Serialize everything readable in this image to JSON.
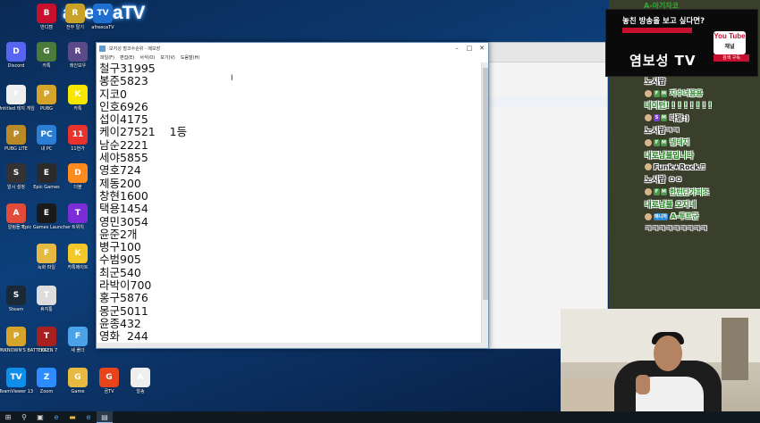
{
  "desktop": {
    "logo_text": "afreecaTV",
    "icons": [
      {
        "label": "반디캠",
        "name": "bandicam-icon",
        "color": "#c8102e",
        "glyph": "B"
      },
      {
        "label": "전부 탈기",
        "name": "tool-icon",
        "color": "#c9a227",
        "glyph": "R"
      },
      {
        "label": "afreecaTV",
        "name": "afreecatv-icon",
        "color": "#1f6fd0",
        "glyph": "TV"
      },
      {
        "label": "Discord",
        "name": "discord-icon",
        "color": "#5865f2",
        "glyph": "D"
      },
      {
        "label": "카톡",
        "name": "game-icon",
        "color": "#4c7a3a",
        "glyph": "G"
      },
      {
        "label": "레인보우",
        "name": "rainbow-icon",
        "color": "#5a4a8a",
        "glyph": "R"
      },
      {
        "label": "Untitled 테지 게임",
        "name": "file-icon",
        "color": "#eeeeee",
        "glyph": "F"
      },
      {
        "label": "PUBG",
        "name": "pubg-icon",
        "color": "#d4a52a",
        "glyph": "P"
      },
      {
        "label": "카톡",
        "name": "kakao-icon",
        "color": "#f7e600",
        "glyph": "K"
      },
      {
        "label": "PUBG LITE",
        "name": "pubg-lite-icon",
        "color": "#b98a26",
        "glyph": "P"
      },
      {
        "label": "내 PC",
        "name": "pc-icon",
        "color": "#2a7fd4",
        "glyph": "PC"
      },
      {
        "label": "11번가",
        "name": "11st-icon",
        "color": "#e8322b",
        "glyph": "11"
      },
      {
        "label": "알시 설정",
        "name": "settings-icon",
        "color": "#333333",
        "glyph": "S"
      },
      {
        "label": "Epic Games",
        "name": "epic-icon",
        "color": "#2b2b2b",
        "glyph": "E"
      },
      {
        "label": "더블",
        "name": "double-icon",
        "color": "#ff8a1d",
        "glyph": "D"
      },
      {
        "label": "알림돌기",
        "name": "alert-icon",
        "color": "#e24a3a",
        "glyph": "A"
      },
      {
        "label": "Epic Games Launcher",
        "name": "epic-launcher-icon",
        "color": "#1a1a1a",
        "glyph": "E"
      },
      {
        "label": "트위치",
        "name": "twitch-icon",
        "color": "#7d2dd8",
        "glyph": "T"
      },
      {
        "label": "",
        "name": "blank-icon",
        "color": "#e8e8e8",
        "glyph": ""
      },
      {
        "label": "녹화 파일",
        "name": "folder-icon",
        "color": "#e6b940",
        "glyph": "F"
      },
      {
        "label": "카톡메이트",
        "name": "play-icon",
        "color": "#f2c928",
        "glyph": "K"
      },
      {
        "label": "Steam",
        "name": "steam-icon",
        "color": "#1b2838",
        "glyph": "S"
      },
      {
        "label": "휴지통",
        "name": "trash-icon",
        "color": "#dddddd",
        "glyph": "T"
      },
      {
        "label": "PLAYERUNKNOWN'S BATTLEG...",
        "name": "pubg-full-icon",
        "color": "#d4a52a",
        "glyph": "P"
      },
      {
        "label": "TEKKEN 7",
        "name": "tekken-icon",
        "color": "#a82020",
        "glyph": "T"
      },
      {
        "label": "새 폴더",
        "name": "new-folder-icon",
        "color": "#4aa3e8",
        "glyph": "F"
      },
      {
        "label": "TeamViewer 13",
        "name": "teamviewer-icon",
        "color": "#0e8ee9",
        "glyph": "TV"
      },
      {
        "label": "Zoom",
        "name": "zoom-icon",
        "color": "#2d8cff",
        "glyph": "Z"
      },
      {
        "label": "Game",
        "name": "game-folder-icon",
        "color": "#e6b940",
        "glyph": "G"
      },
      {
        "label": "곰TV",
        "name": "gomtv-icon",
        "color": "#e8441c",
        "glyph": "G"
      },
      {
        "label": "알송",
        "name": "alsong-icon",
        "color": "#eeeeee",
        "glyph": "A"
      }
    ]
  },
  "notepad": {
    "title": "보지성 벌코수순위 - 메모장",
    "menu": [
      "파일(F)",
      "편집(E)",
      "서식(O)",
      "보기(V)",
      "도움말(H)"
    ],
    "lines": [
      "철구31995",
      "봉준5823",
      "지코0",
      "인호6926",
      "섭이4175",
      "케이27521    1등",
      "남순2221",
      "세야5855",
      "영호724",
      "제동200",
      "창현1600",
      "택용1454",
      "영민3054",
      "윤준2개",
      "병구100",
      "수범905",
      "최군540",
      "라박이700",
      "홍구5876",
      "몽군5011",
      "윤종432",
      "영화  244"
    ]
  },
  "banner": {
    "top_nick": "A-아기자코",
    "subtitle": "놓친 방송을 보고 싶다면?",
    "main": "염보성 TV",
    "yt_logo": "You Tube",
    "yt_sub": "채널",
    "subscribe": "검색 구독"
  },
  "chat": [
    {
      "nick": "",
      "msg": "노시랍",
      "badges": []
    },
    {
      "nick": "지수녀용용",
      "msg": "",
      "badges": [
        "F",
        "M"
      ],
      "nick_color": "#2a8a2a"
    },
    {
      "nick": "",
      "msg": "네이턴! ! ! ! ! ! ! !",
      "badges": [],
      "msg_color": "#1a7a1a"
    },
    {
      "nick": "다랑:)",
      "msg": "",
      "badges": [
        "S",
        "M"
      ],
      "nick_color": "#2a2a2a"
    },
    {
      "nick": "",
      "msg": "노시랍ㅋㅋ",
      "badges": []
    },
    {
      "nick": "넴테지",
      "msg": "",
      "badges": [
        "F",
        "M"
      ],
      "nick_color": "#2a8a2a"
    },
    {
      "nick": "",
      "msg": "내로남불입니다",
      "badges": [],
      "msg_color": "#1a7a1a"
    },
    {
      "nick": "Funk★Rock♬",
      "msg": "",
      "badges": [],
      "nick_color": "#2a2a2a"
    },
    {
      "nick": "",
      "msg": "노시랍 ㅇㅇ",
      "badges": []
    },
    {
      "nick": "한턴단가피조",
      "msg": "",
      "badges": [
        "F",
        "M"
      ],
      "nick_color": "#2a8a2a"
    },
    {
      "nick": "",
      "msg": "내로남불 오지네",
      "badges": [],
      "msg_color": "#1a7a1a"
    },
    {
      "nick": "A-투트군",
      "msg": "",
      "badges": [
        "매니저"
      ],
      "nick_color": "#2a8a2a"
    },
    {
      "nick": "",
      "msg": "ㅋㅋㅋㅋㅋㅋㅋㅋㅋ",
      "badges": []
    }
  ],
  "colors": {
    "desktop_bg": "#0d3f7a",
    "chat_bg": "#3a3f2c",
    "banner_bg": "#0a0a0a",
    "accent_red": "#c8102e"
  }
}
